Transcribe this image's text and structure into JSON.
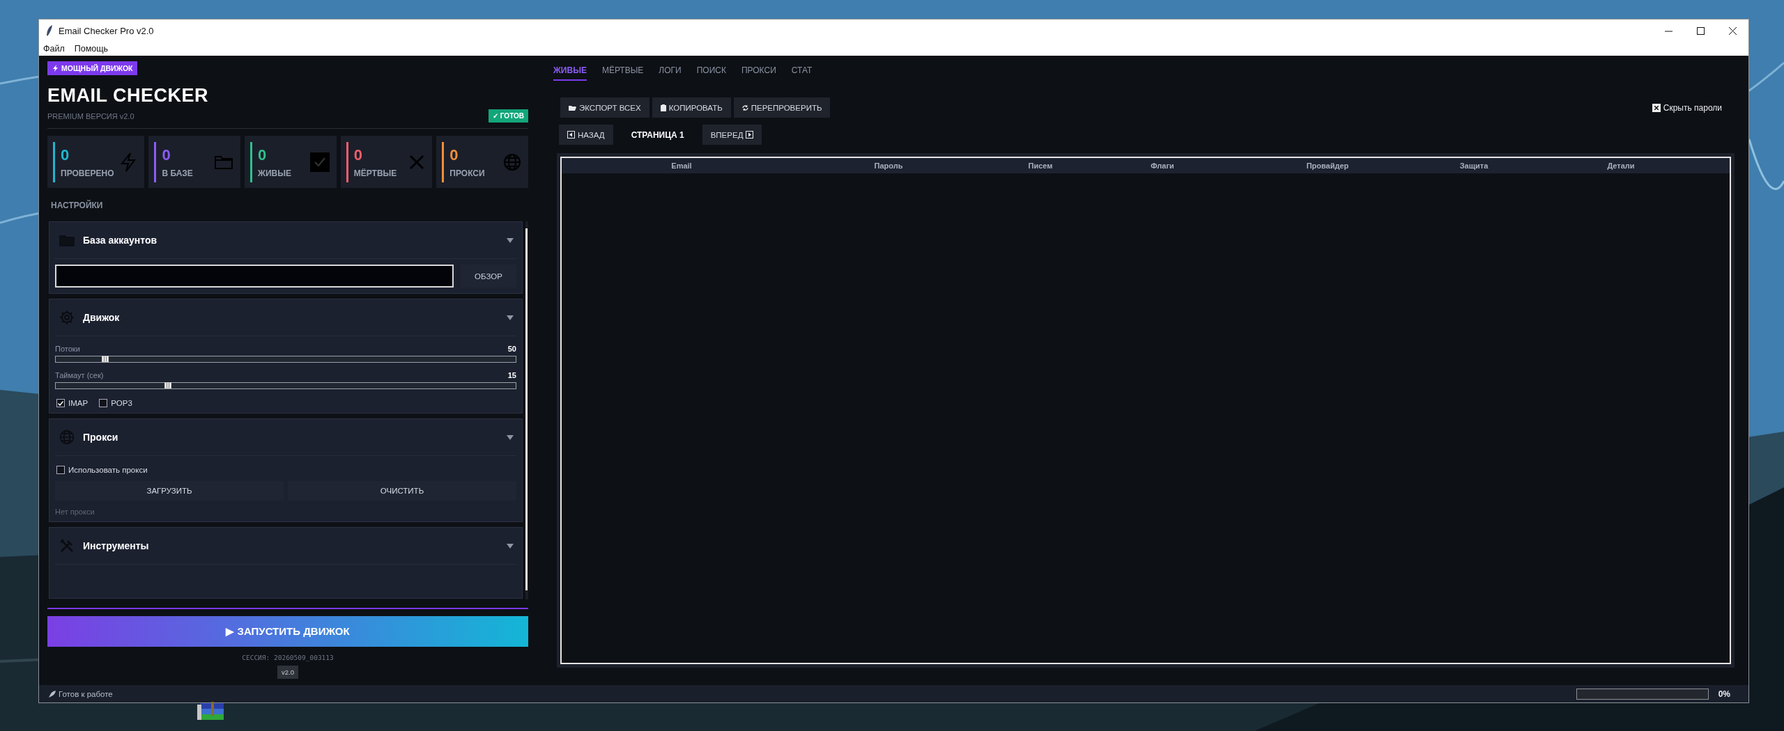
{
  "window": {
    "title": "Email Checker Pro v2.0",
    "menu": [
      "Файл",
      "Помощь"
    ]
  },
  "sidebar": {
    "badge": "МОЩНЫЙ ДВИЖОК",
    "title": "EMAIL CHECKER",
    "subtitle": "PREMIUM ВЕРСИЯ v2.0",
    "status_badge": "✓ ГОТОВ",
    "stats": [
      {
        "kind": "bolt",
        "value": "0",
        "label": "ПРОВЕРЕНО",
        "color": "#1fb6d0"
      },
      {
        "kind": "folder",
        "value": "0",
        "label": "В БАЗЕ",
        "color": "#8b5cf6"
      },
      {
        "kind": "check",
        "value": "0",
        "label": "ЖИВЫЕ",
        "color": "#2fbf8a"
      },
      {
        "kind": "cross",
        "value": "0",
        "label": "МЁРТВЫЕ",
        "color": "#ef5f6b"
      },
      {
        "kind": "globe",
        "value": "0",
        "label": "ПРОКСИ",
        "color": "#f0903a"
      }
    ],
    "settings_label": "НАСТРОЙКИ",
    "sections": [
      {
        "kind": "file",
        "title": "База аккаунтов",
        "button": "ОБЗОР"
      },
      {
        "kind": "engine",
        "title": "Движок",
        "sliders": [
          {
            "label": "Потоки",
            "reading": "50",
            "level": 0.108
          },
          {
            "label": "Таймаут (сек)",
            "reading": "15",
            "level": 0.244
          }
        ],
        "options": [
          {
            "label": "IMAP",
            "checked": true
          },
          {
            "label": "POP3",
            "checked": false
          }
        ]
      },
      {
        "kind": "proxy",
        "title": "Прокси",
        "option": {
          "label": "Использовать прокси",
          "checked": false
        },
        "buttons": [
          "ЗАГРУЗИТЬ",
          "ОЧИСТИТЬ"
        ],
        "note": "Нет прокси"
      },
      {
        "kind": "tools",
        "title": "Инструменты"
      }
    ],
    "launch_button": "▶ ЗАПУСТИТЬ ДВИЖОК",
    "session": "СЕССИЯ: 20260509_003113",
    "version": "v2.0"
  },
  "main": {
    "tabs": [
      {
        "label": "ЖИВЫЕ",
        "selected": true
      },
      {
        "label": "МЁРТВЫЕ",
        "selected": false
      },
      {
        "label": "ЛОГИ",
        "selected": false
      },
      {
        "label": "ПОИСК",
        "selected": false
      },
      {
        "label": "ПРОКСИ",
        "selected": false
      },
      {
        "label": "СТАТ",
        "selected": false
      }
    ],
    "actions": [
      {
        "kind": "export",
        "label": "ЭКСПОРТ ВСЕХ"
      },
      {
        "kind": "copy",
        "label": "КОПИРОВАТЬ"
      },
      {
        "kind": "recheck",
        "label": "ПЕРЕПРОВЕРИТЬ"
      }
    ],
    "hide_passwords": {
      "label": "Скрыть пароли",
      "checked": true
    },
    "pager": {
      "prev": "НАЗАД",
      "page": "СТРАНИЦА 1",
      "next": "ВПЕРЕД"
    },
    "table": {
      "columns": [
        "Email",
        "Пароль",
        "Писем",
        "Флаги",
        "Провайдер",
        "Защита",
        "Детали"
      ]
    }
  },
  "status_bar": {
    "text": "Готов к работе",
    "progress": {
      "level": 0,
      "reading": "0%"
    }
  }
}
